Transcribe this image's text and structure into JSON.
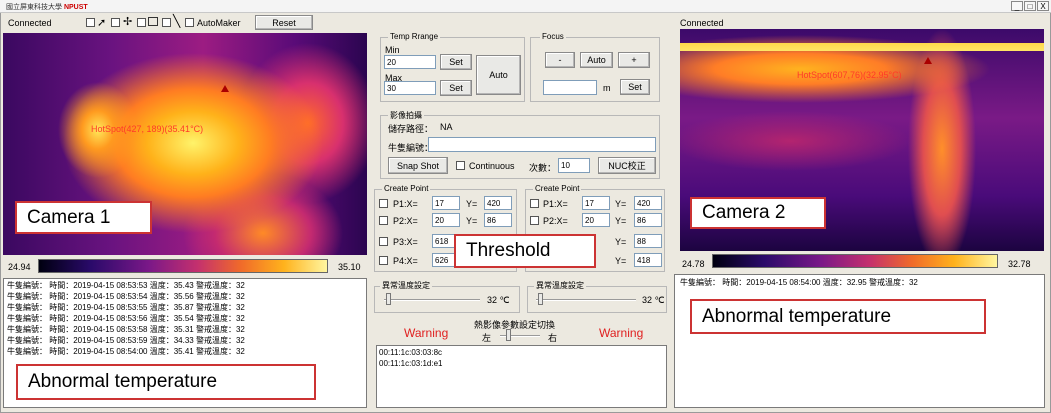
{
  "window": {
    "logo_text": "國立屏東科技大學",
    "logo_badge": "NPUST",
    "controls": [
      "_",
      "□",
      "X"
    ]
  },
  "toolbar": {
    "status": "Connected",
    "automaker_label": "AutoMaker",
    "reset_label": "Reset"
  },
  "camera1": {
    "hotspot_text": "HotSpot(427, 189)(35.41°C)",
    "scale_min": "24.94",
    "scale_max": "35.10"
  },
  "camera2": {
    "status": "Connected",
    "hotspot_text": "HotSpot(607,76)(32.95°C)",
    "scale_min": "24.78",
    "scale_max": "32.78"
  },
  "temp_range": {
    "title": "Temp Rrange",
    "min_label": "Min",
    "min_value": "20",
    "max_label": "Max",
    "max_value": "30",
    "set_label": "Set",
    "auto_label": "Auto"
  },
  "focus": {
    "title": "Focus",
    "minus_label": "-",
    "auto_label": "Auto",
    "plus_label": "+",
    "value": "",
    "unit": "m",
    "set_label": "Set"
  },
  "capture": {
    "title": "影像拍攝",
    "path_label": "儲存路徑：",
    "path_value": "NA",
    "cow_id_label": "牛隻編號：",
    "cow_id_value": "",
    "snapshot_label": "Snap Shot",
    "continuous_label": "Continuous",
    "count_label": "次數：",
    "count_value": "10",
    "nuc_label": "NUC校正"
  },
  "create_point_left": {
    "title": "Create Point",
    "points": [
      {
        "label": "P1:X=",
        "x": "17",
        "y_label": "Y=",
        "y": "420"
      },
      {
        "label": "P2:X=",
        "x": "20",
        "y_label": "Y=",
        "y": "86"
      },
      {
        "label": "P3:X=",
        "x": "618"
      },
      {
        "label": "P4:X=",
        "x": "626"
      }
    ]
  },
  "create_point_right": {
    "title": "Create Point",
    "points": [
      {
        "label": "P1:X=",
        "x": "17",
        "y_label": "Y=",
        "y": "420"
      },
      {
        "label": "P2:X=",
        "x": "20",
        "y_label": "Y=",
        "y": "86"
      },
      {
        "y_label": "Y=",
        "y": "88"
      },
      {
        "y_label": "Y=",
        "y": "418"
      }
    ]
  },
  "abnormal_left": {
    "title": "異常溫度設定",
    "value": "32 ℃"
  },
  "abnormal_right": {
    "title": "異常溫度設定",
    "value": "32 ℃"
  },
  "switch": {
    "title": "熱影像參數設定切換",
    "left_label": "左",
    "right_label": "右",
    "warning_left": "Warning",
    "warning_right": "Warning"
  },
  "mac_log": [
    "00:11:1c:03:03:8c",
    "00:11:1c:03:1d:e1"
  ],
  "log_left": [
    "牛隻編號：    時間：2019-04-15 08:53:53  溫度：35.43   警戒溫度：32",
    "牛隻編號：    時間：2019-04-15 08:53:54  溫度：35.56   警戒溫度：32",
    "牛隻編號：    時間：2019-04-15 08:53:55  溫度：35.87   警戒溫度：32",
    "牛隻編號：    時間：2019-04-15 08:53:56  溫度：35.54   警戒溫度：32",
    "牛隻編號：    時間：2019-04-15 08:53:58  溫度：35.31   警戒溫度：32",
    "牛隻編號：    時間：2019-04-15 08:53:59  溫度：34.33   警戒溫度：32",
    "牛隻編號：    時間：2019-04-15 08:54:00  溫度：35.41   警戒溫度：32"
  ],
  "log_right": [
    "牛隻編號：    時間：2019-04-15 08:54:00  溫度：32.95   警戒溫度：32"
  ],
  "callouts": {
    "camera1": "Camera 1",
    "camera2": "Camera 2",
    "threshold": "Threshold",
    "abnormal_left": "Abnormal temperature",
    "abnormal_right": "Abnormal temperature"
  }
}
